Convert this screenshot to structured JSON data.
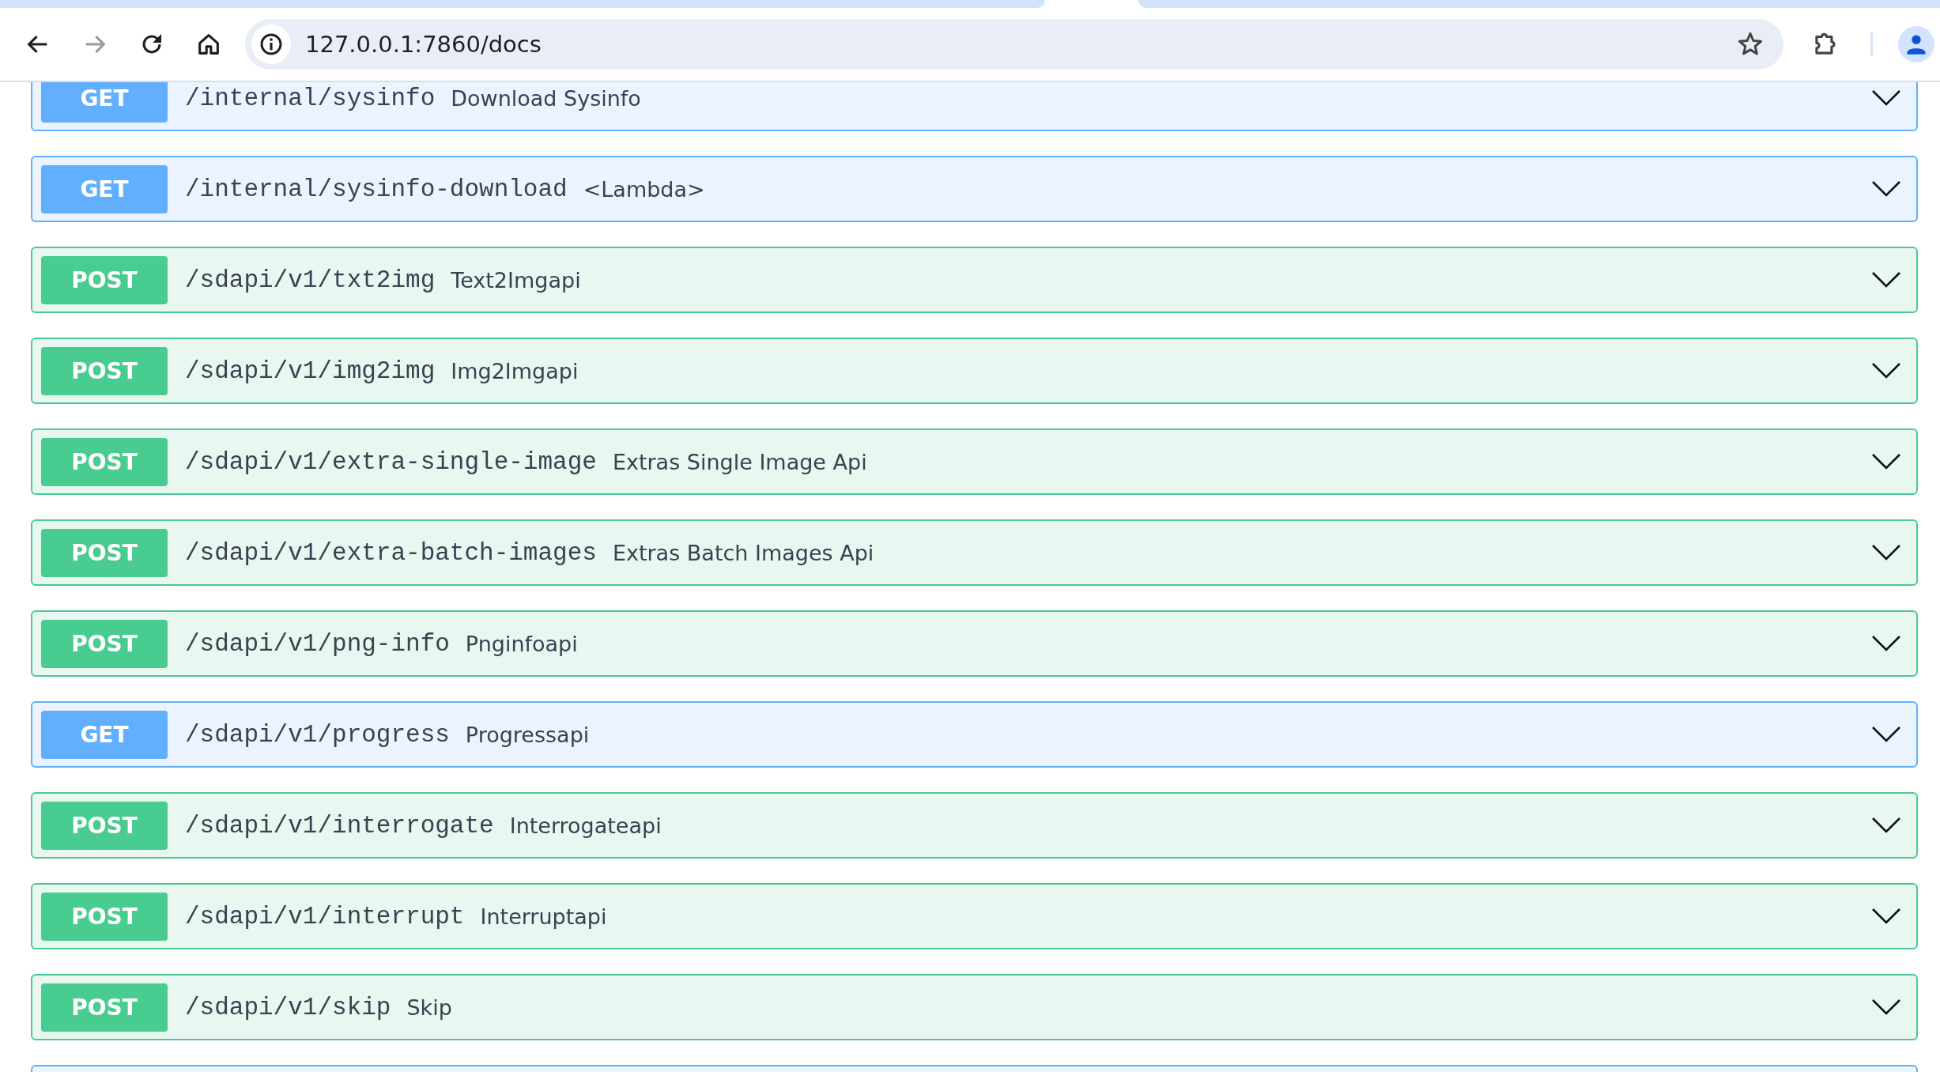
{
  "toolbar": {
    "forward_disabled": true,
    "url": "127.0.0.1:7860/docs"
  },
  "operations": [
    {
      "kind": "get",
      "method": "GET",
      "path": "/internal/sysinfo",
      "summary": "Download Sysinfo"
    },
    {
      "kind": "get",
      "method": "GET",
      "path": "/internal/sysinfo-download",
      "summary": "<Lambda>"
    },
    {
      "kind": "post",
      "method": "POST",
      "path": "/sdapi/v1/txt2img",
      "summary": "Text2Imgapi"
    },
    {
      "kind": "post",
      "method": "POST",
      "path": "/sdapi/v1/img2img",
      "summary": "Img2Imgapi"
    },
    {
      "kind": "post",
      "method": "POST",
      "path": "/sdapi/v1/extra-single-image",
      "summary": "Extras Single Image Api"
    },
    {
      "kind": "post",
      "method": "POST",
      "path": "/sdapi/v1/extra-batch-images",
      "summary": "Extras Batch Images Api"
    },
    {
      "kind": "post",
      "method": "POST",
      "path": "/sdapi/v1/png-info",
      "summary": "Pnginfoapi"
    },
    {
      "kind": "get",
      "method": "GET",
      "path": "/sdapi/v1/progress",
      "summary": "Progressapi"
    },
    {
      "kind": "post",
      "method": "POST",
      "path": "/sdapi/v1/interrogate",
      "summary": "Interrogateapi"
    },
    {
      "kind": "post",
      "method": "POST",
      "path": "/sdapi/v1/interrupt",
      "summary": "Interruptapi"
    },
    {
      "kind": "post",
      "method": "POST",
      "path": "/sdapi/v1/skip",
      "summary": "Skip"
    },
    {
      "kind": "get"
    }
  ]
}
